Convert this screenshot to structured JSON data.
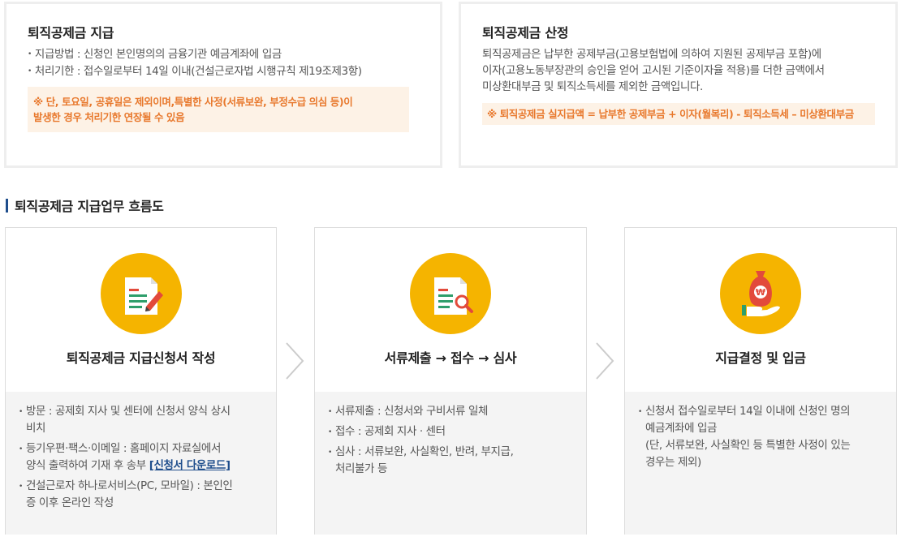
{
  "payment": {
    "title": "퇴직공제금 지급",
    "items": [
      "지급방법 : 신청인 본인명의의 금융기관 예금계좌에 입금",
      "처리기한 : 접수일로부터 14일 이내(건설근로자법 시행규칙 제19조제3항)"
    ],
    "note_line1": "※ 단, 토요일, 공휴일은 제외이며,특별한 사정(서류보완, 부정수급 의심 등)이",
    "note_line2": "발생한 경우 처리기한 연장될 수 있음"
  },
  "calculation": {
    "title": "퇴직공제금 산정",
    "lines": [
      "퇴직공제금은 납부한 공제부금(고용보험법에 의하여 지원된 공제부금 포함)에",
      "이자(고용노동부장관의 승인을 얻어 고시된 기준이자율 적용)를 더한 금액에서",
      "미상환대부금 및 퇴직소득세를 제외한 금액입니다."
    ],
    "formula": "※ 퇴직공제금 실지급액 = 납부한 공제부금 + 이자(월복리) - 퇴직소득세 – 미상환대부금"
  },
  "flow": {
    "title": "퇴직공제금 지급업무 흐름도",
    "steps": [
      {
        "icon": "document-pen-icon",
        "title": "퇴직공제금 지급신청서 작성",
        "item1_line1": "방문 : 공제회 지사 및 센터에 신청서 양식 상시",
        "item1_line2": "비치",
        "item2_line1": "등기우편·팩스·이메일 : 홈페이지 자료실에서",
        "item2_line2": "양식 출력하여 기재 후 송부 ",
        "item2_link": "[신청서 다운로드]",
        "item3_line1": "건설근로자 하나로서비스(PC, 모바일) : 본인인",
        "item3_line2": "증 이후 온라인 작성"
      },
      {
        "icon": "document-search-icon",
        "title": "서류제출 → 접수 → 심사",
        "item1": "서류제출 : 신청서와 구비서류 일체",
        "item2": "접수 : 공제회 지사 · 센터",
        "item3_line1": "심사 : 서류보완, 사실확인, 반려, 부지급,",
        "item3_line2": "처리불가 등"
      },
      {
        "icon": "money-bag-hand-icon",
        "title": "지급결정 및 입금",
        "item1_line1": "신청서 접수일로부터 14일 이내에 신청인 명의",
        "item1_line2": "예금계좌에 입금",
        "item1_line3": "(단, 서류보완, 사실확인 등 특별한 사정이 있는",
        "item1_line4": "경우는 제외)"
      }
    ]
  },
  "colors": {
    "accent_orange": "#e8782c",
    "note_bg": "#fdf2e6",
    "icon_circle": "#f5b400",
    "heading_bar": "#1f4e8c",
    "link": "#1f4e8c"
  }
}
